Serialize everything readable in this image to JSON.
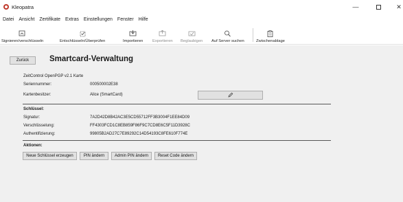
{
  "window": {
    "title": "Kleopatra"
  },
  "menu": [
    "Datei",
    "Ansicht",
    "Zertifikate",
    "Extras",
    "Einstellungen",
    "Fenster",
    "Hilfe"
  ],
  "toolbar": {
    "items": [
      {
        "label": "Signieren/verschlüsseln",
        "icon": "sign-encrypt-icon",
        "enabled": true
      },
      {
        "label": "Entschlüsseln/Überprüfen",
        "icon": "decrypt-verify-icon",
        "enabled": true
      },
      {
        "label": "Importieren",
        "icon": "import-icon",
        "enabled": true
      },
      {
        "label": "Exportieren",
        "icon": "export-icon",
        "enabled": false
      },
      {
        "label": "Beglaubigen",
        "icon": "certify-icon",
        "enabled": false
      },
      {
        "label": "Auf Server suchen",
        "icon": "search-icon",
        "enabled": true
      },
      {
        "label": "Zwischenablage",
        "icon": "clipboard-icon",
        "enabled": true
      }
    ]
  },
  "page": {
    "back_label": "Zurück",
    "title": "Smartcard-Verwaltung",
    "card_type": "ZeitControl OpenPGP v2.1 Karte",
    "serial": {
      "label": "Seriennummer:",
      "value": "000500002E38"
    },
    "holder": {
      "label": "Kartenbesitzer:",
      "value": "Alice (SmartCard)",
      "edit_icon": "pencil-icon"
    },
    "keys": {
      "heading": "Schlüssel:",
      "rows": [
        {
          "label": "Signatur:",
          "value": "7A2D42D8B42AC3E5CD55712FF3B3004F1EE84D09"
        },
        {
          "label": "Verschlüsselung:",
          "value": "FF4303FCD1C8EB859F86F9C7CD8E6C5F11D3928C"
        },
        {
          "label": "Authentifizierung:",
          "value": "99805B2AD27C7E89292C14D54193C8FE610F774E"
        }
      ]
    },
    "actions": {
      "heading": "Aktionen:",
      "buttons": [
        "Neue Schlüssel erzeugen",
        "PIN ändern",
        "Admin PIN ändern",
        "Reset Code ändern"
      ]
    }
  }
}
